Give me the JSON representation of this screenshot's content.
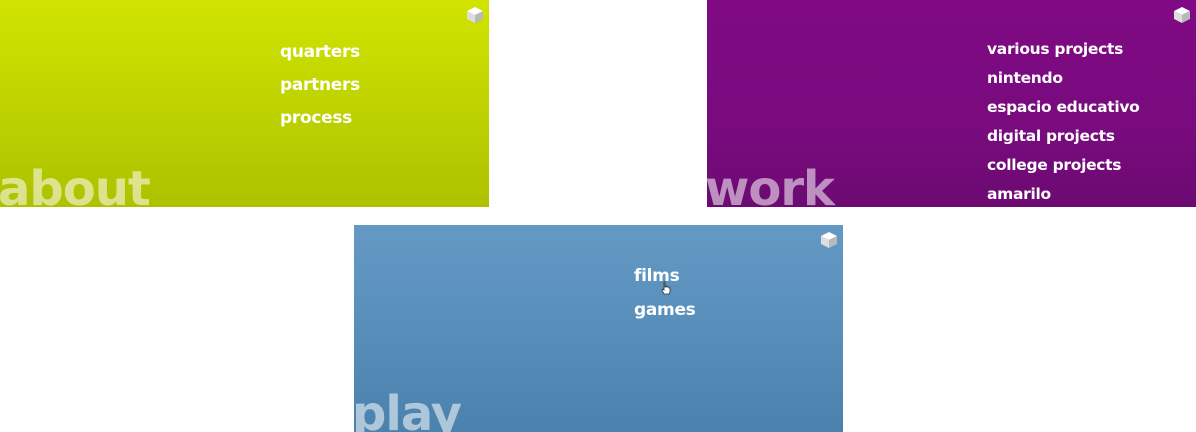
{
  "panels": {
    "about": {
      "title": "about",
      "color": "#c4d800",
      "items": [
        "quarters",
        "partners",
        "process"
      ]
    },
    "work": {
      "title": "work",
      "color": "#7b0a80",
      "items": [
        "various projects",
        "nintendo",
        "espacio educativo",
        "digital projects",
        "college projects",
        "amarilo"
      ]
    },
    "play": {
      "title": "play",
      "color": "#5a8fba",
      "items": [
        "films",
        "games"
      ]
    }
  },
  "icons": {
    "corner_button": "cube-icon",
    "pointer": "hand-cursor-icon"
  }
}
